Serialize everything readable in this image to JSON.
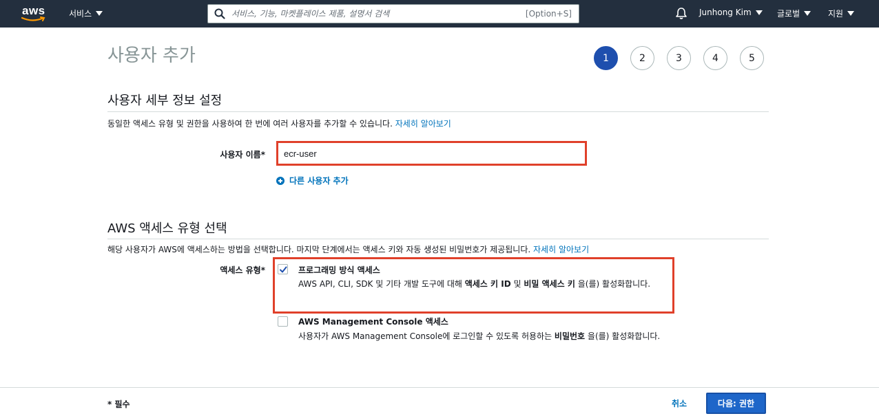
{
  "nav": {
    "logo_text": "aws",
    "services_label": "서비스",
    "search_placeholder": "서비스, 기능, 마켓플레이스 제품, 설명서 검색",
    "search_shortcut": "[Option+S]",
    "user_name": "Junhong Kim",
    "region_label": "글로벌",
    "support_label": "지원"
  },
  "page": {
    "title": "사용자 추가",
    "steps": [
      "1",
      "2",
      "3",
      "4",
      "5"
    ],
    "active_step": "1"
  },
  "user_details": {
    "heading": "사용자 세부 정보 설정",
    "description": "동일한 액세스 유형 및 권한을 사용하여 한 번에 여러 사용자를 추가할 수 있습니다.",
    "learn_more": "자세히 알아보기",
    "username_label": "사용자 이름*",
    "username_value": "ecr-user",
    "add_user_link": "다른 사용자 추가"
  },
  "access_type": {
    "heading": "AWS 액세스 유형 선택",
    "description": "해당 사용자가 AWS에 액세스하는 방법을 선택합니다. 마지막 단계에서는 액세스 키와 자동 생성된 비밀번호가 제공됩니다.",
    "learn_more": "자세히 알아보기",
    "label": "액세스 유형*",
    "options": [
      {
        "title": "프로그래밍 방식 액세스",
        "desc_before": "AWS API, CLI, SDK 및 기타 개발 도구에 대해 ",
        "desc_bold1": "액세스 키 ID",
        "desc_mid": " 및 ",
        "desc_bold2": "비밀 액세스 키",
        "desc_after": " 을(를) 활성화합니다.",
        "checked": true
      },
      {
        "title": "AWS Management Console 액세스",
        "desc_before": "사용자가 AWS Management Console에 로그인할 수 있도록 허용하는 ",
        "desc_bold1": "비밀번호",
        "desc_after": " 을(를) 활성화합니다.",
        "checked": false
      }
    ]
  },
  "footer": {
    "required_note": "* 필수",
    "cancel_label": "취소",
    "next_label": "다음: 권한"
  },
  "colors": {
    "nav_bg": "#232f3e",
    "accent_blue": "#1e66c9",
    "link_blue": "#0073bb",
    "highlight_red": "#e0402a"
  }
}
